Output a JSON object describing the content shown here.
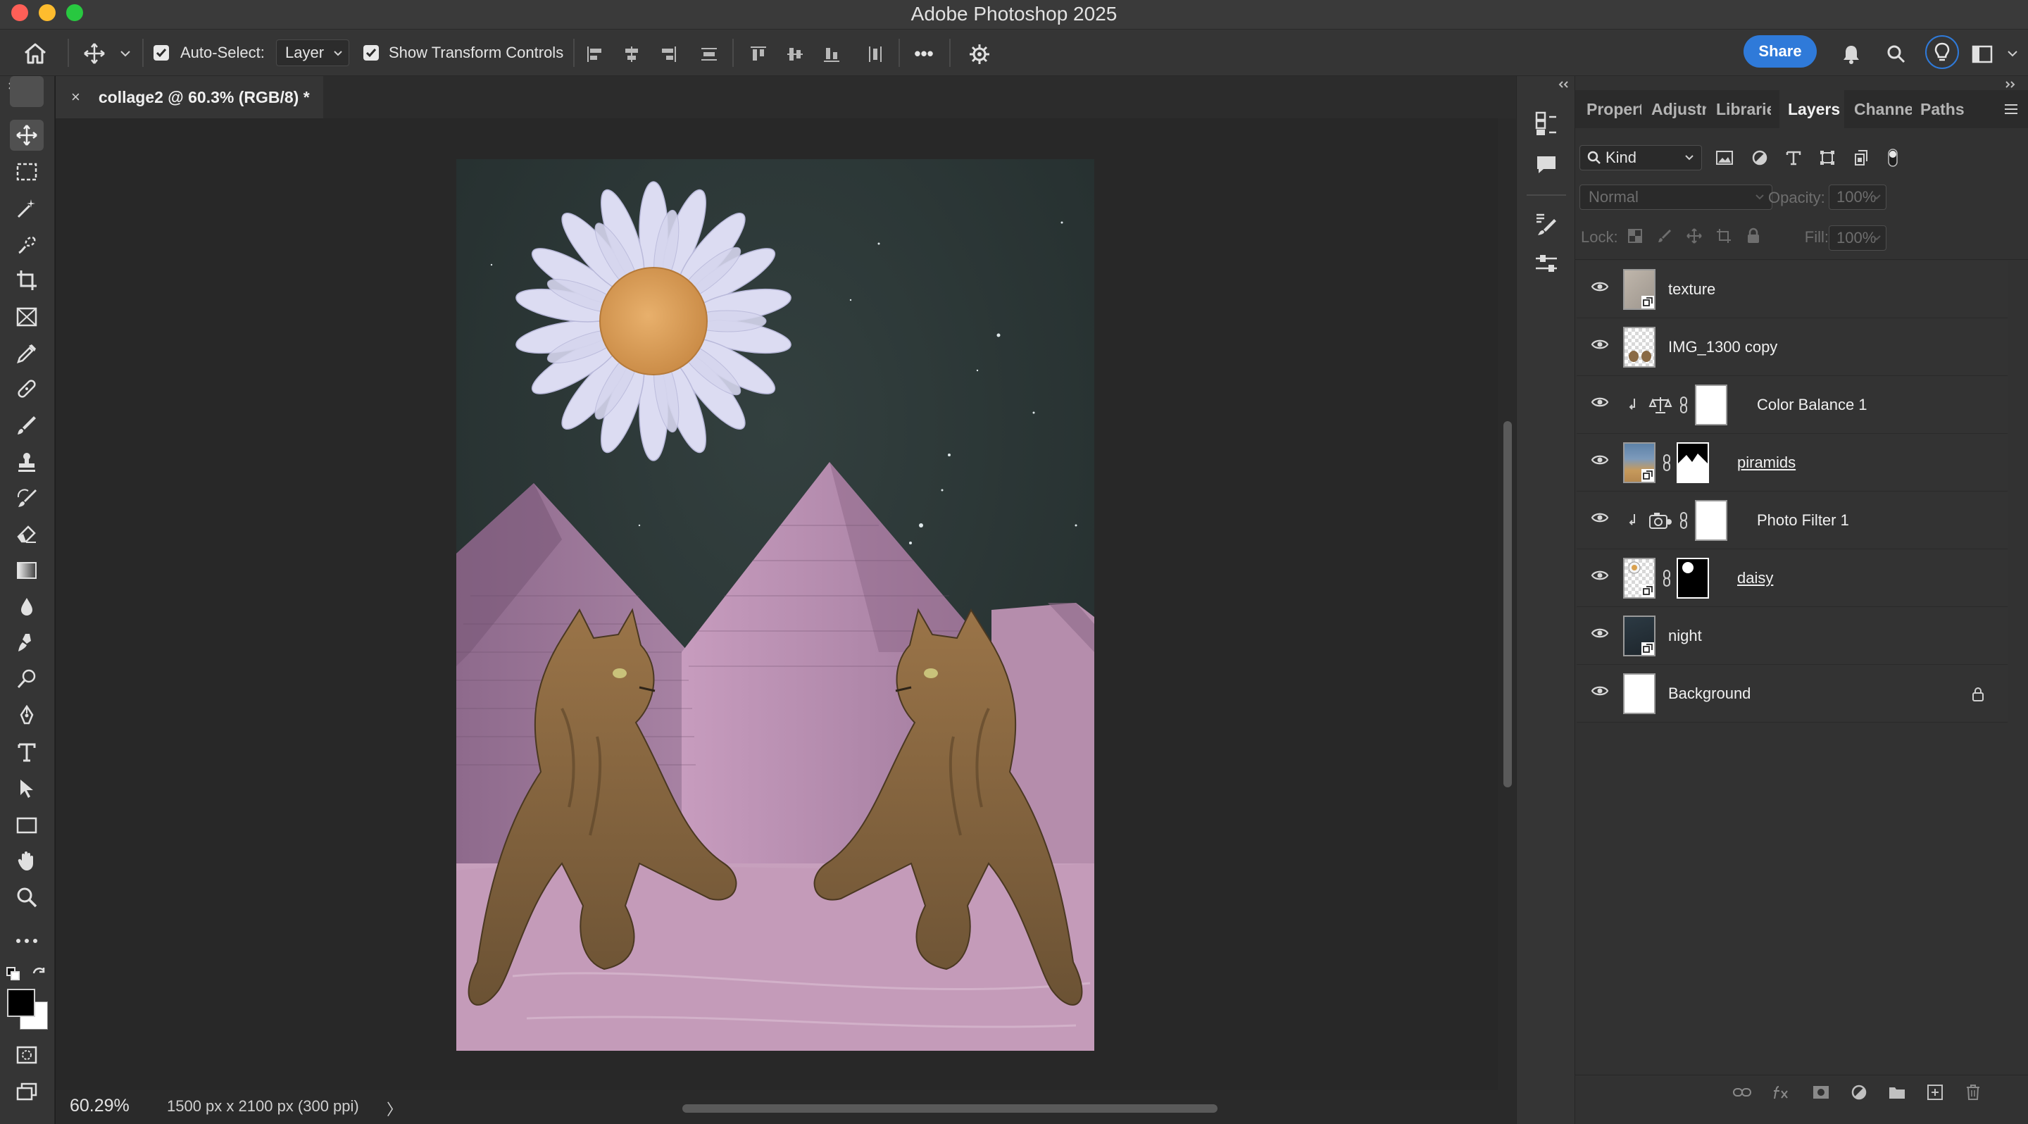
{
  "window": {
    "title": "Adobe Photoshop 2025",
    "traffic_colors": [
      "#ff5f57",
      "#febc2e",
      "#28c840"
    ]
  },
  "options_bar": {
    "auto_select_label": "Auto-Select:",
    "auto_select_checked": true,
    "auto_select_target": "Layer",
    "show_transform_label": "Show Transform Controls",
    "show_transform_checked": true,
    "more_label": "•••",
    "share_label": "Share",
    "accent_color": "#2f7ad9"
  },
  "document": {
    "tab_title": "collage2 @ 60.3% (RGB/8) *",
    "close_glyph": "×",
    "zoom": "60.29%",
    "doc_size": "1500 px x 2100 px (300 ppi)",
    "status_arrow": "〉"
  },
  "toolbar": {
    "tools": [
      "move-tool",
      "rectangular-marquee-tool",
      "object-selection-tool",
      "quick-selection-tool",
      "crop-tool",
      "frame-tool",
      "eyedropper-tool",
      "spot-healing-tool",
      "brush-tool",
      "clone-stamp-tool",
      "history-brush-tool",
      "eraser-tool",
      "gradient-tool",
      "blur-tool",
      "dodge-tool",
      "pen-tool",
      "type-tool",
      "path-selection-tool",
      "rectangle-tool",
      "hand-tool",
      "zoom-tool",
      "edit-toolbar"
    ],
    "active_tool": "move-tool",
    "foreground_color": "#000000",
    "background_color": "#ffffff"
  },
  "panels": {
    "tabs": [
      "Propert",
      "Adjustr",
      "Librarie",
      "Layers",
      "Channe",
      "Paths"
    ],
    "active_tab": "Layers",
    "filter_kind": "Kind",
    "blend_mode": "Normal",
    "opacity_label": "Opacity:",
    "opacity_value": "100%",
    "lock_label": "Lock:",
    "fill_label": "Fill:",
    "fill_value": "100%"
  },
  "layers": [
    {
      "name": "texture",
      "type": "smart-object",
      "linked_name": false
    },
    {
      "name": "IMG_1300 copy",
      "type": "smart-object-transparent",
      "linked_name": false
    },
    {
      "name": "Color Balance 1",
      "type": "adjustment-color-balance",
      "clipped": true
    },
    {
      "name": "piramids",
      "type": "smart-object-masked",
      "linked_name": true
    },
    {
      "name": "Photo Filter 1",
      "type": "adjustment-photo-filter",
      "clipped": true
    },
    {
      "name": "daisy",
      "type": "smart-object-masked",
      "linked_name": true
    },
    {
      "name": "night",
      "type": "smart-object",
      "linked_name": false
    },
    {
      "name": "Background",
      "type": "background",
      "locked": true
    }
  ]
}
